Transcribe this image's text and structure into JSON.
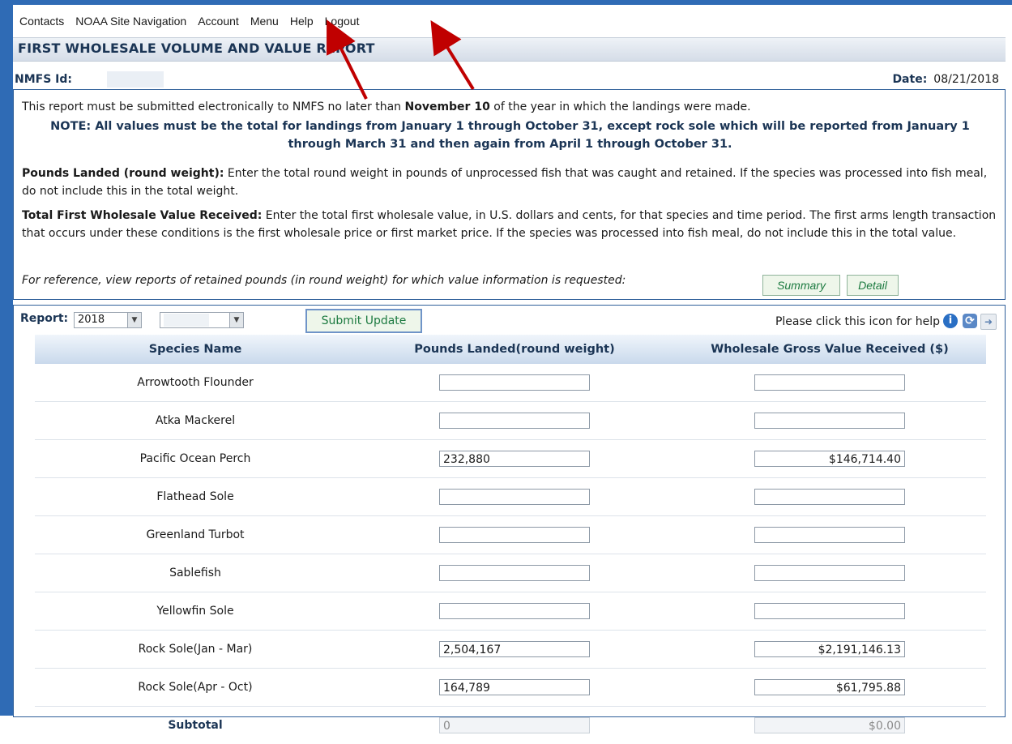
{
  "nav": [
    "Contacts",
    "NOAA Site Navigation",
    "Account",
    "Menu",
    "Help",
    "Logout"
  ],
  "title": "FIRST WHOLESALE VOLUME AND VALUE REPORT",
  "id_label": "NMFS Id:",
  "date_label": "Date:",
  "date_value": "08/21/2018",
  "info": {
    "p1_pre": "This report must be submitted electronically to NMFS no later than ",
    "p1_bold": "November 10",
    "p1_post": " of the year in which the landings were made.",
    "note": "NOTE: All values must be the total for landings from January 1 through October 31, except rock sole which will be reported from January 1 through March 31 and then again from April 1 through October 31.",
    "pounds_bold": "Pounds Landed (round weight):",
    "pounds_text": " Enter the total round weight in pounds of unprocessed fish that was caught and retained. If the species was processed into fish meal, do not include this in the total weight.",
    "value_bold": "Total First Wholesale Value Received:",
    "value_text": " Enter the total first wholesale value, in U.S. dollars and cents, for that species and time period. The first arms length transaction that occurs under these conditions is the first wholesale price or first market price. If the species was processed into fish meal, do not include this in the total value.",
    "reference": "For reference, view reports of retained pounds (in round weight) for which value information is requested:",
    "summary_btn": "Summary",
    "detail_btn": "Detail"
  },
  "report": {
    "label": "Report:",
    "year": "2018",
    "submit": "Submit Update",
    "help_text": "Please click this icon for help"
  },
  "table": {
    "headers": [
      "Species Name",
      "Pounds Landed(round weight)",
      "Wholesale Gross Value Received ($)"
    ],
    "rows": [
      {
        "species": "Arrowtooth Flounder",
        "pounds": "",
        "value": ""
      },
      {
        "species": "Atka Mackerel",
        "pounds": "",
        "value": ""
      },
      {
        "species": "Pacific Ocean Perch",
        "pounds": "232,880",
        "value": "$146,714.40"
      },
      {
        "species": "Flathead Sole",
        "pounds": "",
        "value": ""
      },
      {
        "species": "Greenland Turbot",
        "pounds": "",
        "value": ""
      },
      {
        "species": "Sablefish",
        "pounds": "",
        "value": ""
      },
      {
        "species": "Yellowfin Sole",
        "pounds": "",
        "value": ""
      },
      {
        "species": "Rock Sole(Jan - Mar)",
        "pounds": "2,504,167",
        "value": "$2,191,146.13"
      },
      {
        "species": "Rock Sole(Apr - Oct)",
        "pounds": "164,789",
        "value": "$61,795.88"
      }
    ],
    "subtotal": {
      "label": "Subtotal",
      "pounds": "0",
      "value": "$0.00"
    }
  },
  "colors": {
    "frame": "#2f6bb5",
    "heading": "#1b3555",
    "button_text": "#1c7a40",
    "arrow": "#c00000"
  }
}
